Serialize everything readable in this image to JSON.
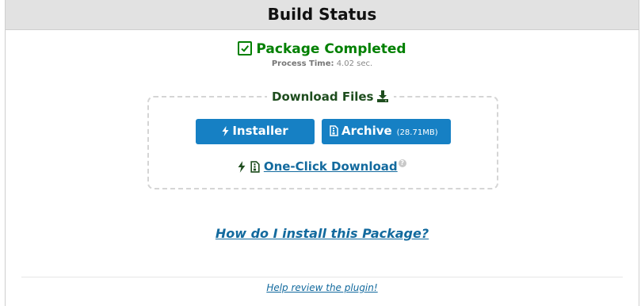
{
  "header": {
    "title": "Build Status"
  },
  "status": {
    "label": "Package Completed",
    "process_time_label": "Process Time:",
    "process_time_value": "4.02 sec."
  },
  "download": {
    "legend": "Download Files",
    "installer_label": "Installer",
    "archive_label": "Archive",
    "archive_size": "(28.71MB)",
    "one_click_label": "One-Click Download",
    "help_marker": "?"
  },
  "links": {
    "how_to_install": "How do I install this Package?",
    "review": "Help review the plugin!"
  },
  "colors": {
    "success": "#008000",
    "button": "#1680c4",
    "link": "#136a9e",
    "header_bg": "#e2e2e2"
  },
  "icons": {
    "status": "check-square-icon",
    "legend": "download-icon",
    "installer": "bolt-icon",
    "archive": "file-archive-icon"
  }
}
